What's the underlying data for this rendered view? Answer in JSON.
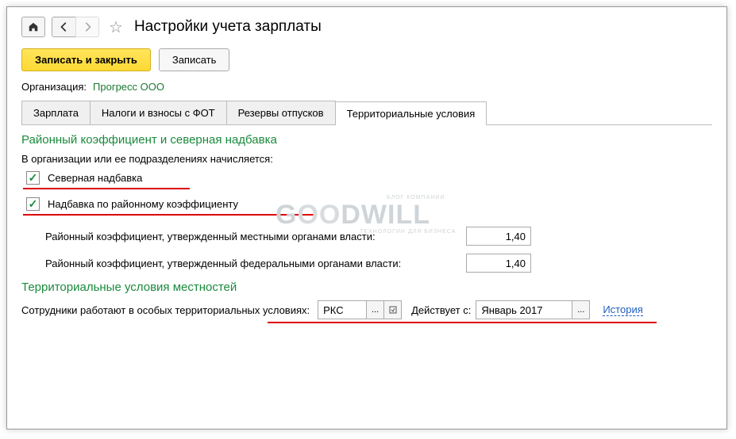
{
  "header": {
    "title": "Настройки учета зарплаты"
  },
  "toolbar": {
    "save_close_label": "Записать и закрыть",
    "save_label": "Записать"
  },
  "org": {
    "label": "Организация:",
    "value": "Прогресс ООО"
  },
  "tabs": [
    {
      "label": "Зарплата"
    },
    {
      "label": "Налоги и взносы с ФОТ"
    },
    {
      "label": "Резервы отпусков"
    },
    {
      "label": "Территориальные условия"
    }
  ],
  "section1": {
    "title": "Районный коэффициент и северная надбавка",
    "sub_label": "В организации или ее подразделениях начисляется:",
    "check1_label": "Северная надбавка",
    "check2_label": "Надбавка по районному коэффициенту",
    "coef1_label": "Районный коэффициент, утвержденный местными органами власти:",
    "coef1_value": "1,40",
    "coef2_label": "Районный коэффициент, утвержденный федеральными органами власти:",
    "coef2_value": "1,40"
  },
  "section2": {
    "title": "Территориальные условия местностей",
    "label": "Сотрудники работают в особых территориальных условиях:",
    "territory_value": "РКС",
    "from_label": "Действует с:",
    "date_value": "Январь 2017",
    "history_label": "История"
  }
}
